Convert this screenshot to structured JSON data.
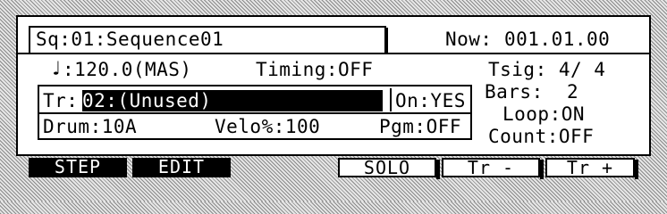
{
  "header": {
    "sequence_label": "Sq:01:Sequence01",
    "now_label": "Now:",
    "now_value": "001.01.00"
  },
  "row1": {
    "note_glyph": "♩",
    "tempo": ":120.0(MAS)",
    "timing": "Timing:OFF",
    "tsig": "Tsig: 4/ 4"
  },
  "track": {
    "tr_label": "Tr:",
    "tr_value": "02:(Unused)",
    "on_value": "On:YES",
    "drum": "Drum:10A",
    "velo": "Velo%:100",
    "pgm": "Pgm:OFF"
  },
  "right_panel": {
    "bars": "Bars:  2",
    "loop": "Loop:ON",
    "count": "Count:OFF"
  },
  "softkeys": {
    "step": "STEP",
    "edit": "EDIT",
    "solo": "SOLO",
    "tr_minus": "Tr -",
    "tr_plus": "Tr +"
  }
}
